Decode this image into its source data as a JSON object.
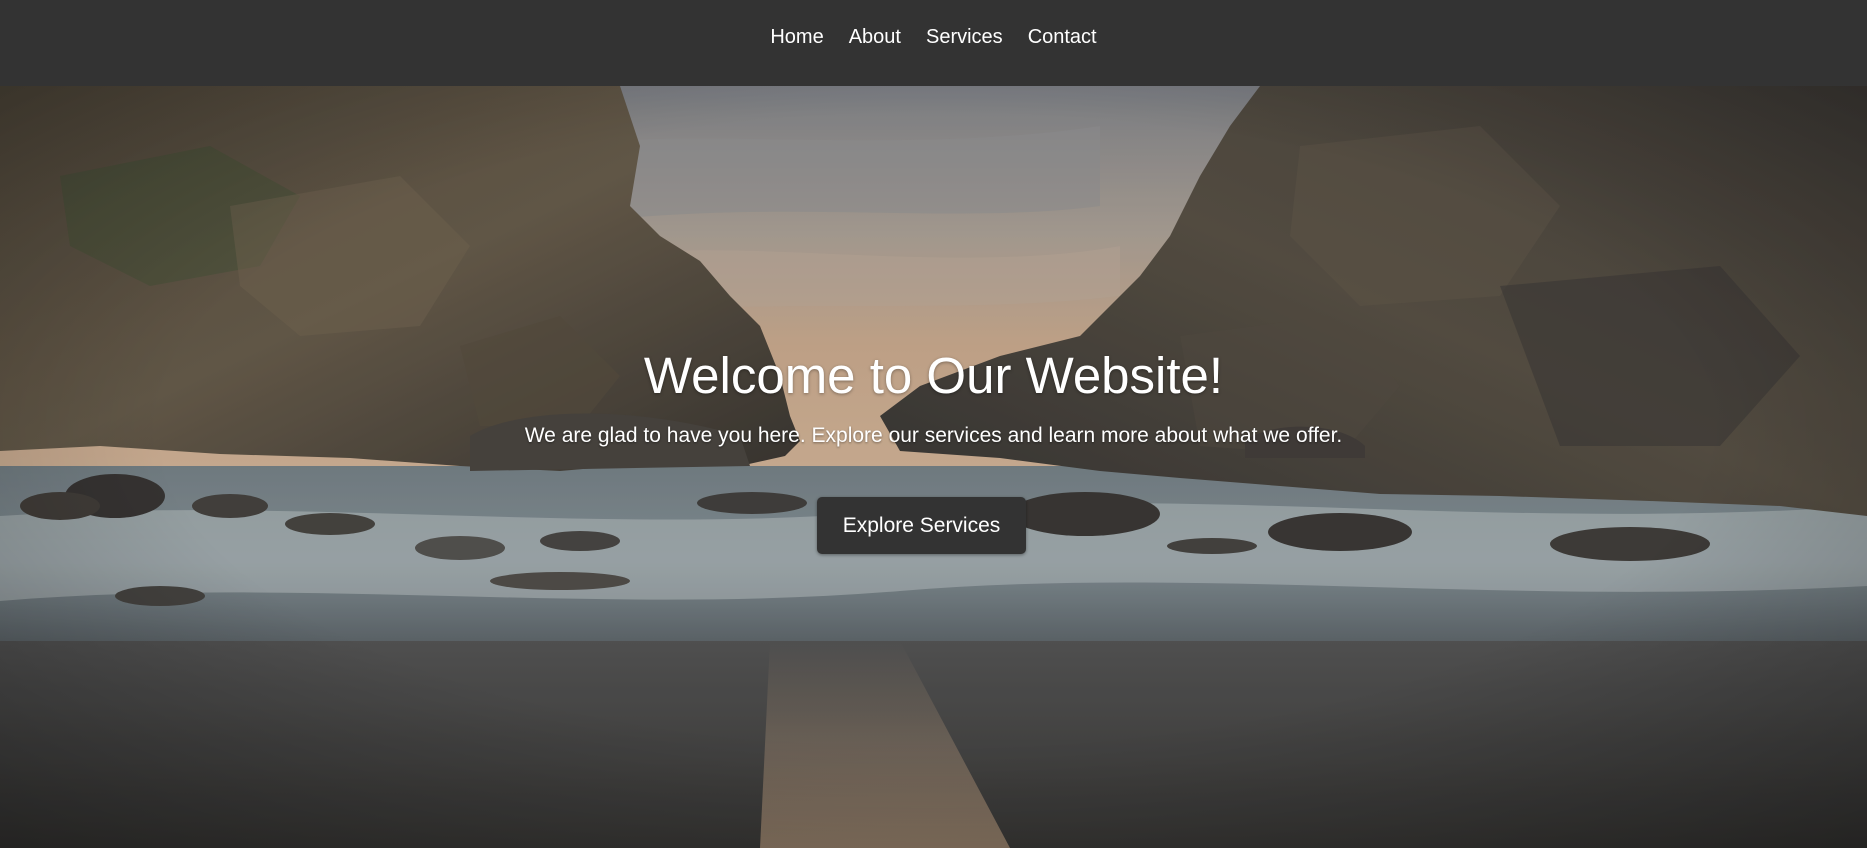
{
  "nav": {
    "items": [
      {
        "label": "Home"
      },
      {
        "label": "About"
      },
      {
        "label": "Services"
      },
      {
        "label": "Contact"
      }
    ]
  },
  "hero": {
    "title": "Welcome to Our Website!",
    "subtitle": "We are glad to have you here. Explore our services and learn more about what we offer.",
    "cta_label": "Explore Services",
    "background": "coastal rocks and sea at sunset"
  },
  "colors": {
    "nav_background": "#333333",
    "button_background": "#333333",
    "text": "#ffffff"
  }
}
